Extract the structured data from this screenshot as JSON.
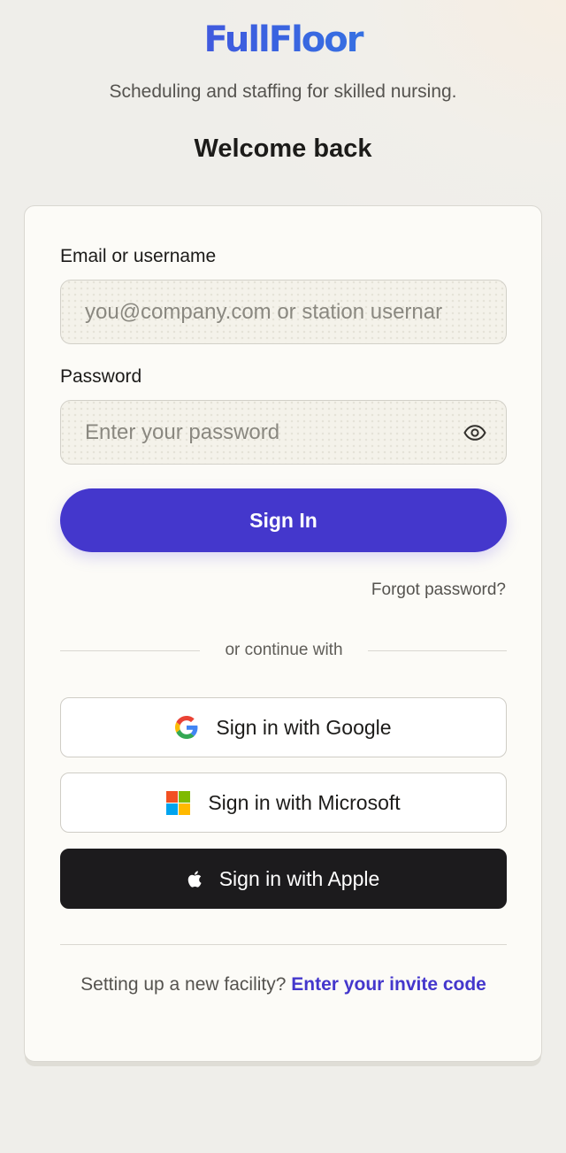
{
  "brand": {
    "logo": "FullFloor",
    "tagline": "Scheduling and staffing for skilled nursing."
  },
  "heading": "Welcome back",
  "form": {
    "email_label": "Email or username",
    "email_placeholder": "you@company.com or station usernar",
    "email_value": "",
    "password_label": "Password",
    "password_placeholder": "Enter your password",
    "password_value": "",
    "password_toggle_icon": "eye-icon",
    "sign_in_label": "Sign In",
    "forgot_label": "Forgot password?"
  },
  "divider": {
    "label": "or continue with"
  },
  "sso": {
    "google": {
      "label": "Sign in with Google",
      "icon": "google-icon"
    },
    "microsoft": {
      "label": "Sign in with Microsoft",
      "icon": "microsoft-icon"
    },
    "apple": {
      "label": "Sign in with Apple",
      "icon": "apple-icon"
    }
  },
  "footer": {
    "prompt": "Setting up a new facility?",
    "link": "Enter your invite code"
  },
  "colors": {
    "accent": "#4437cc",
    "logo_gradient_start": "#4f3fd9",
    "logo_gradient_end": "#2d8fe6",
    "apple_button": "#1c1b1d",
    "card_background": "#fcfbf7",
    "page_background": "#efeeea"
  }
}
